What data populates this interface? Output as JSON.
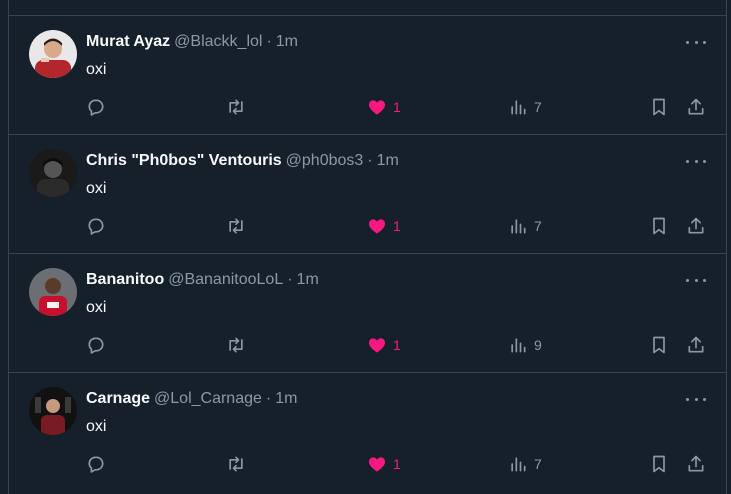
{
  "colors": {
    "background": "#15202b",
    "divider": "#38444d",
    "text_primary": "#f7f9f9",
    "text_secondary": "#8b98a5",
    "like_active": "#f91880"
  },
  "tweets": [
    {
      "name": "Murat Ayaz",
      "handle": "@Blackk_lol",
      "dot": "·",
      "time": "1m",
      "text": "oxi",
      "likes": "1",
      "views": "7",
      "liked": true,
      "avatar_icon": "avatar-photo"
    },
    {
      "name": "Chris \"Ph0bos\" Ventouris",
      "handle": "@ph0bos3",
      "dot": "·",
      "time": "1m",
      "text": "oxi",
      "likes": "1",
      "views": "7",
      "liked": true,
      "avatar_icon": "avatar-photo"
    },
    {
      "name": "Bananitoo",
      "handle": "@BananitooLoL",
      "dot": "·",
      "time": "1m",
      "text": "oxi",
      "likes": "1",
      "views": "9",
      "liked": true,
      "avatar_icon": "avatar-photo"
    },
    {
      "name": "Carnage",
      "handle": "@Lol_Carnage",
      "dot": "·",
      "time": "1m",
      "text": "oxi",
      "likes": "1",
      "views": "7",
      "liked": true,
      "avatar_icon": "avatar-photo"
    }
  ],
  "icons": {
    "reply": "reply-icon",
    "retweet": "retweet-icon",
    "like": "heart-icon",
    "views": "views-icon",
    "bookmark": "bookmark-icon",
    "share": "share-icon",
    "more": "more-icon"
  }
}
